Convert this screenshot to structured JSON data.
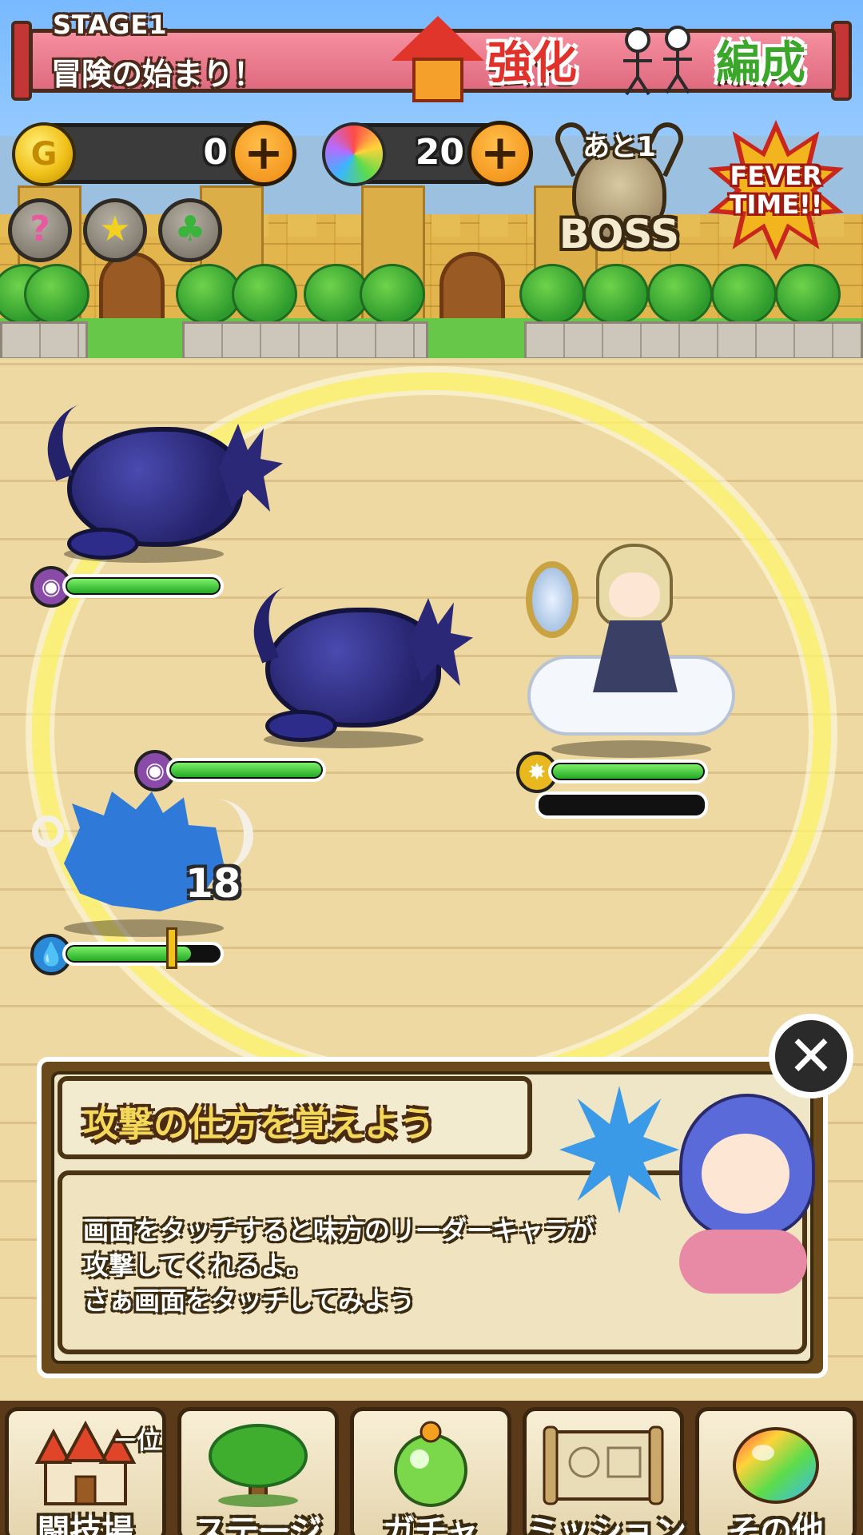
{
  "header": {
    "stage_label": "STAGE1",
    "stage_title": "冒険の始まり！",
    "upgrade_label": "強化",
    "formation_label": "編成"
  },
  "currency": {
    "gold_value": "0",
    "gem_value": "20"
  },
  "boss": {
    "remaining": "あと1",
    "label": "BOSS"
  },
  "fever": {
    "line1": "FEVER",
    "line2": "TIME!!"
  },
  "status_buttons": [
    {
      "icon": "question-icon",
      "glyph": "?"
    },
    {
      "icon": "star-icon",
      "glyph": "★"
    },
    {
      "icon": "clover-icon",
      "glyph": "♣"
    }
  ],
  "enemies": [
    {
      "name": "dark blob",
      "attribute": "dark",
      "hp": 1.0
    },
    {
      "name": "dark blob",
      "attribute": "dark",
      "hp": 1.0
    },
    {
      "name": "blue boar",
      "attribute": "water",
      "hp": 0.82
    }
  ],
  "damage_popup": "18",
  "hero": {
    "attribute": "light",
    "hp": 1.0,
    "skill": 0.0
  },
  "tutorial": {
    "title": "攻撃の仕方を覚えよう",
    "body": [
      "画面をタッチすると味方のリーダーキャラが",
      "攻撃してくれるよ。",
      "さぁ画面をタッチしてみよう"
    ],
    "close_glyph": "✕"
  },
  "nav": {
    "rank_badge": "－位",
    "items": [
      {
        "label": "闘技場",
        "icon": "castle-icon"
      },
      {
        "label": "ステージ",
        "icon": "tree-icon"
      },
      {
        "label": "ガチャ",
        "icon": "gacha-orb-icon"
      },
      {
        "label": "ミッション",
        "icon": "scroll-map-icon"
      },
      {
        "label": "その他",
        "icon": "rainbow-gem-icon"
      }
    ]
  },
  "colors": {
    "hp_green": "#24a924",
    "banner_pink": "#e06a80",
    "ring_yellow": "#fff56e"
  }
}
